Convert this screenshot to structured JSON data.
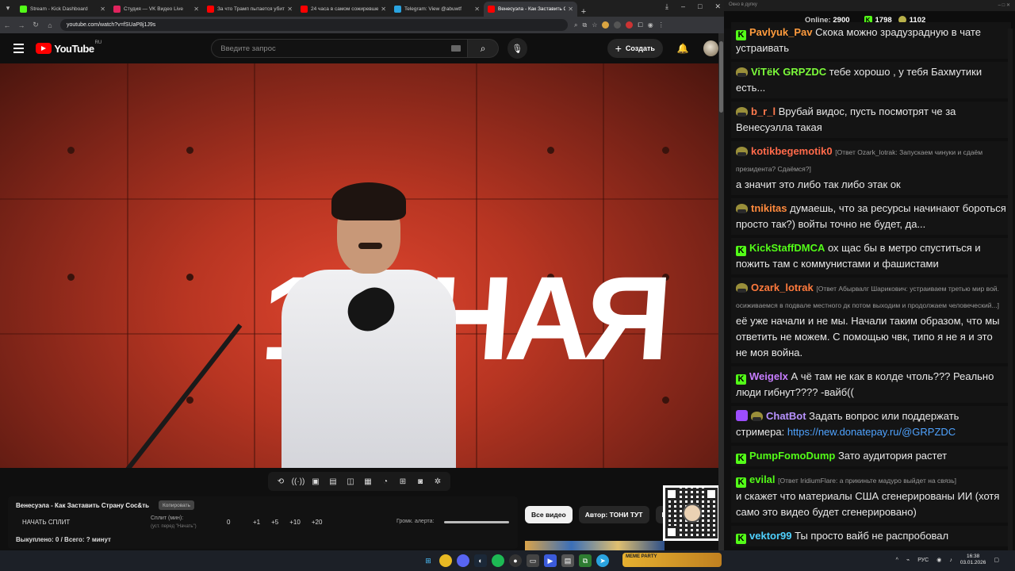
{
  "browser": {
    "tabs": [
      {
        "label": "Stream - Kick Dashboard",
        "fav": "#53fc18",
        "active": false
      },
      {
        "label": "Студия — VK Видео Live",
        "fav": "#e0245e",
        "active": false
      },
      {
        "label": "За что Трамп пытается убить",
        "fav": "#ff0000",
        "active": false
      },
      {
        "label": "24 часа в самом сожиревшем",
        "fav": "#ff0000",
        "active": false
      },
      {
        "label": "Telegram: View @abuwtf",
        "fav": "#2aa3df",
        "active": false
      },
      {
        "label": "Венесуэла - Как Заставить Стр",
        "fav": "#ff0000",
        "active": true
      }
    ],
    "url": "youtube.com/watch?v=fSUaP8j1J9s"
  },
  "youtube": {
    "logo": "YouTube",
    "region": "RU",
    "search_placeholder": "Введите запрос",
    "create_label": "Создать"
  },
  "video": {
    "overlay_text": "1 ДНАЯ"
  },
  "player_controls": [
    "repeat-icon",
    "broadcast-icon",
    "cinema-icon",
    "clapper-icon",
    "pip-icon",
    "subtitles-icon",
    "speed-icon",
    "clip-icon",
    "screenshot-icon",
    "settings-icon"
  ],
  "split_panel": {
    "title": "Венесуэла - Как Заставить Страну Сос&ть",
    "copy_label": "Копировать",
    "start_label": "НАЧАТЬ СПЛИТ",
    "split_label": "Сплит (мин):",
    "split_hint": "(уст. перед \"Начать\")",
    "split_value": "0",
    "increments": [
      "+1",
      "+5",
      "+10",
      "+20"
    ],
    "volume_label": "Громк. алерта:",
    "bought": "Выкуплено: 0 / Всего: ? минут"
  },
  "chips": [
    "Все видео",
    "Автор: ТОНИ ТУТ",
    "Нов"
  ],
  "chat": {
    "window_title": "Окно в дупку",
    "online_label": "Online:",
    "online_count": "2900",
    "kick_count": "1798",
    "other_count": "1102",
    "messages": [
      {
        "icons": [
          "k"
        ],
        "user": "Pavlyuk_Pav",
        "color": "#ff9b3d",
        "reply": "",
        "text": "Скока можно зрадузрадную в чате устраивать"
      },
      {
        "icons": [
          "b"
        ],
        "user": "ViTёK GRPZDC",
        "color": "#7cfc3a",
        "reply": "",
        "text": "тебе хорошо , у тебя Бахмутики есть..."
      },
      {
        "icons": [
          "b"
        ],
        "user": "b_r_l",
        "color": "#ff7a4d",
        "reply": "",
        "text": "Врубай видос, пусть посмотрят че за Венесуэлла такая"
      },
      {
        "icons": [
          "b"
        ],
        "user": "kotikbegemotik0",
        "color": "#ff6a4a",
        "reply": "[Ответ Ozark_lotrak: Запускаем чинуки и сдаём президента? Сдаёмся?]",
        "text": "а значит это либо так либо этак ок"
      },
      {
        "icons": [
          "b"
        ],
        "user": "tnikitas",
        "color": "#ff8a3d",
        "reply": "",
        "text": "думаешь, что за ресурсы начинают бороться просто так?) войты точно не будет, да..."
      },
      {
        "icons": [
          "k"
        ],
        "user": "KickStaffDMCA",
        "color": "#53fc18",
        "reply": "",
        "text": "ох щас бы в метро спуститься и пожить там с коммунистами и фашистами"
      },
      {
        "icons": [
          "b"
        ],
        "user": "Ozark_lotrak",
        "color": "#ff7a3d",
        "reply": "[Ответ Абырвалг Шарикович: устраиваем третью мир вой. осиживаемся в подвале местного дк потом выходим и продолжаем человеческий...]",
        "text": "её уже начали и не мы. Начали таким образом, что мы ответить не можем. С помощью чвк, типо я не я и это не моя война."
      },
      {
        "icons": [
          "k"
        ],
        "user": "Weigelx",
        "color": "#c77dff",
        "reply": "",
        "text": "А чё там не как в колде чтоль??? Реально люди гибнут???? -вайб(("
      },
      {
        "icons": [
          "bot",
          "b"
        ],
        "user": "ChatBot",
        "color": "#b892ff",
        "reply": "",
        "text": "Задать вопрос или поддержать стримера:",
        "link": "https://new.donatepay.ru/@GRPZDC"
      },
      {
        "icons": [
          "k"
        ],
        "user": "PumpFomoDump",
        "color": "#53fc18",
        "reply": "",
        "text": "Зато аудитория растет"
      },
      {
        "icons": [
          "k"
        ],
        "user": "evilal",
        "color": "#53fc18",
        "reply": "[Ответ IridiumFlare: а прикиньте мадуро выйдет на связь]",
        "text": "и скажет что материалы США сгенерированы ИИ (хотя само это видео будет сгенерировано)"
      },
      {
        "icons": [
          "k"
        ],
        "user": "vektor99",
        "color": "#4fd1ff",
        "reply": "",
        "text": "Ты просто вайб не распробовал"
      }
    ]
  },
  "taskbar": {
    "tray_label": "MEME PARTY",
    "lang": "РУС",
    "time": "16:38",
    "date": "03.01.2026"
  }
}
